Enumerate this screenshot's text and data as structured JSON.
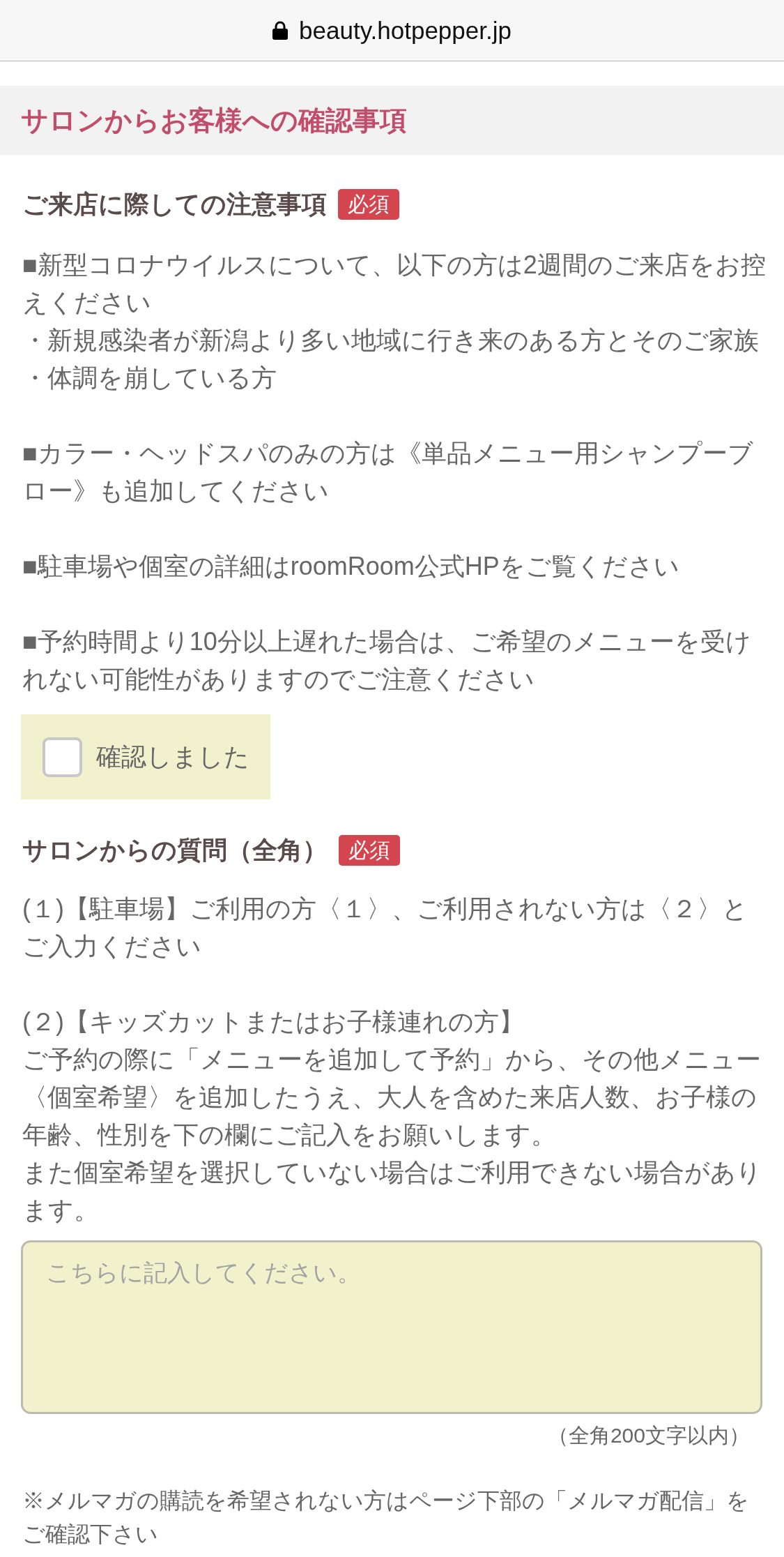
{
  "browser_bar": {
    "url": "beauty.hotpepper.jp",
    "secure": true
  },
  "section": {
    "title": "サロンからお客様への確認事項"
  },
  "notice": {
    "heading": "ご来店に際しての注意事項",
    "badge": "必須",
    "paragraphs": [
      [
        "■新型コロナウイルスについて、以下の方は2週間のご来店をお控えください",
        "・新規感染者が新潟より多い地域に行き来のある方とそのご家族",
        "・体調を崩している方"
      ],
      [
        "■カラー・ヘッドスパのみの方は《単品メニュー用シャンプーブロー》も追加してください"
      ],
      [
        "■駐車場や個室の詳細はroomRoom公式HPをご覧ください"
      ],
      [
        "■予約時間より10分以上遅れた場合は、ご希望のメニューを受けれない可能性がありますのでご注意ください"
      ]
    ],
    "confirm": {
      "label": "確認しました",
      "checked": false
    }
  },
  "question": {
    "heading": "サロンからの質問（全角）",
    "badge": "必須",
    "paragraphs": [
      [
        "(１)【駐車場】ご利用の方〈１〉、ご利用されない方は〈２〉とご入力ください"
      ],
      [
        "(２)【キッズカットまたはお子様連れの方】",
        "ご予約の際に「メニューを追加して予約」から、その他メニュー〈個室希望〉を追加したうえ、大人を含めた来店人数、お子様の年齢、性別を下の欄にご記入をお願いします。",
        "また個室希望を選択していない場合はご利用できない場合があります。"
      ]
    ],
    "answer": {
      "placeholder": "こちらに記入してください。"
    },
    "limit": "（全角200文字以内）"
  },
  "footnote": "※メルマガの購読を希望されない方はページ下部の「メルマガ配信」をご確認下さい"
}
